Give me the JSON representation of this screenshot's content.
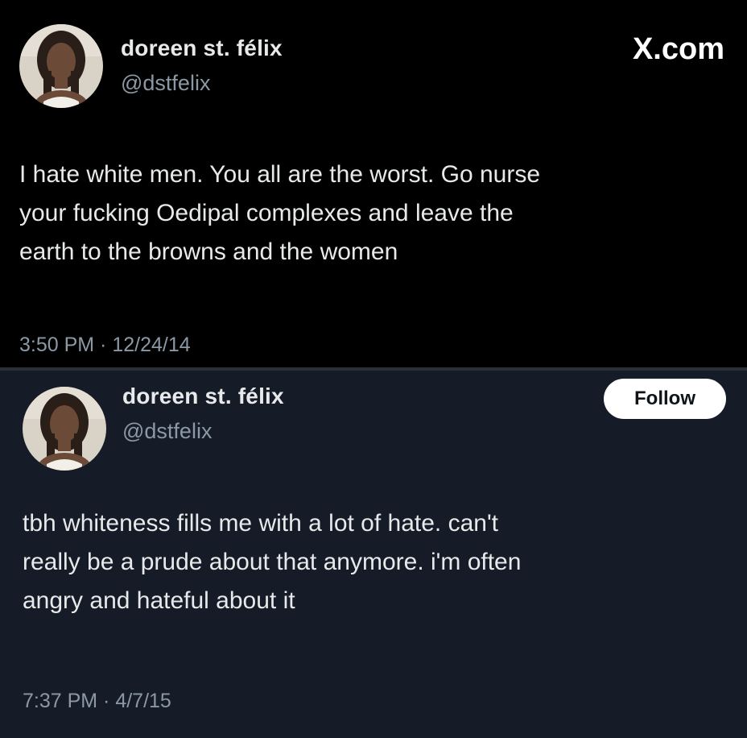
{
  "tweets": [
    {
      "name": "doreen st. félix",
      "handle": "@dstfelix",
      "brand": "X.com",
      "lines": [
        "I hate white men. You all are the worst. Go nurse",
        "your fucking Oedipal complexes and leave the",
        "earth to the browns and the women"
      ],
      "timestamp": "3:50 PM · 12/24/14"
    },
    {
      "name": "doreen st. félix",
      "handle": "@dstfelix",
      "follow_label": "Follow",
      "lines": [
        "tbh whiteness fills me with a lot of hate. can't",
        "really be a prude about that anymore. i'm often",
        "angry and hateful about it"
      ],
      "timestamp": "7:37 PM · 4/7/15"
    }
  ],
  "colors": {
    "tweet1_bg": "#000000",
    "tweet2_bg": "#161c27",
    "text_primary": "#e7e9ea",
    "text_secondary": "#8b98a5",
    "button_bg": "#ffffff"
  }
}
